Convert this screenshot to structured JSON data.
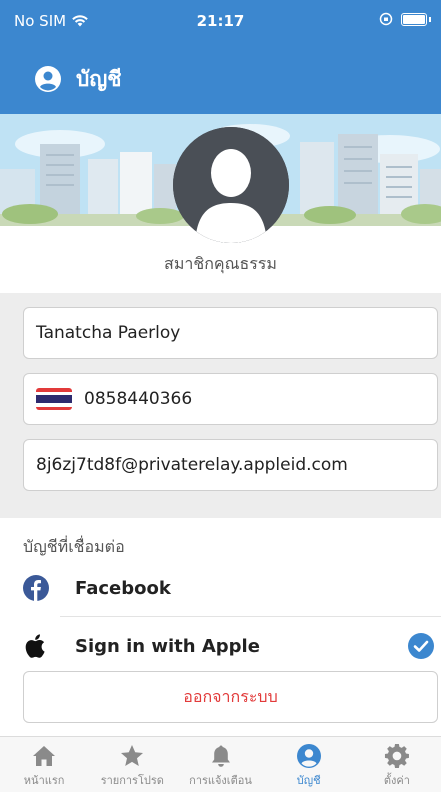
{
  "status_bar": {
    "carrier": "No SIM",
    "time": "21:17"
  },
  "header": {
    "title": "บัญชี"
  },
  "profile": {
    "member_type": "สมาชิกคุณธรรม"
  },
  "form": {
    "name": "Tanatcha Paerloy",
    "phone": "0858440366",
    "email": "8j6zj7td8f@privaterelay.appleid.com"
  },
  "linked_accounts": {
    "title": "บัญชีที่เชื่อมต่อ",
    "items": [
      {
        "label": "Facebook",
        "connected": false
      },
      {
        "label": "Sign in with Apple",
        "connected": true
      }
    ]
  },
  "logout_label": "ออกจากระบบ",
  "tabs": [
    {
      "label": "หน้าแรก",
      "icon": "home-icon",
      "active": false
    },
    {
      "label": "รายการโปรด",
      "icon": "star-icon",
      "active": false
    },
    {
      "label": "การแจ้งเตือน",
      "icon": "bell-icon",
      "active": false
    },
    {
      "label": "บัญชี",
      "icon": "user-circle-icon",
      "active": true
    },
    {
      "label": "ตั้งค่า",
      "icon": "gear-icon",
      "active": false
    }
  ],
  "colors": {
    "primary": "#3c87cf",
    "logout": "#e23a3a",
    "facebook": "#3b5998",
    "check": "#3c87cf"
  }
}
